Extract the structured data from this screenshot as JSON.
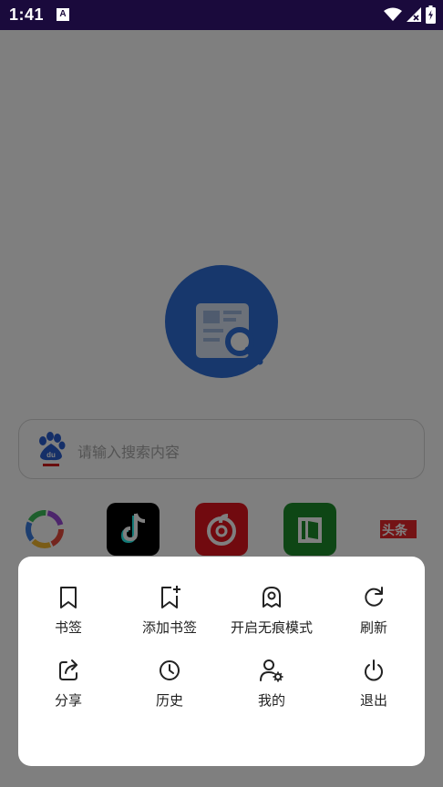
{
  "status_bar": {
    "time": "1:41",
    "notification_badge": "A",
    "icons": [
      "wifi-icon",
      "signal-x-icon",
      "battery-charging-icon"
    ]
  },
  "background_page": {
    "logo_icon": "newspaper-search-icon",
    "search": {
      "engine_icon": "baidu-paw-icon",
      "engine_badge": "du",
      "placeholder": "请输入搜索内容"
    },
    "shortcuts": [
      {
        "icon": "colorful-flower-icon"
      },
      {
        "icon": "tiktok-icon"
      },
      {
        "icon": "netease-music-icon"
      },
      {
        "icon": "green-book-icon"
      },
      {
        "icon": "toutiao-icon",
        "label": "头条"
      }
    ]
  },
  "menu": {
    "items": [
      {
        "icon": "bookmark-icon",
        "label": "书签"
      },
      {
        "icon": "add-bookmark-icon",
        "label": "添加书签"
      },
      {
        "icon": "incognito-ghost-icon",
        "label": "开启无痕模式"
      },
      {
        "icon": "refresh-icon",
        "label": "刷新"
      },
      {
        "icon": "share-icon",
        "label": "分享"
      },
      {
        "icon": "history-clock-icon",
        "label": "历史"
      },
      {
        "icon": "user-settings-icon",
        "label": "我的"
      },
      {
        "icon": "power-icon",
        "label": "退出"
      }
    ]
  }
}
